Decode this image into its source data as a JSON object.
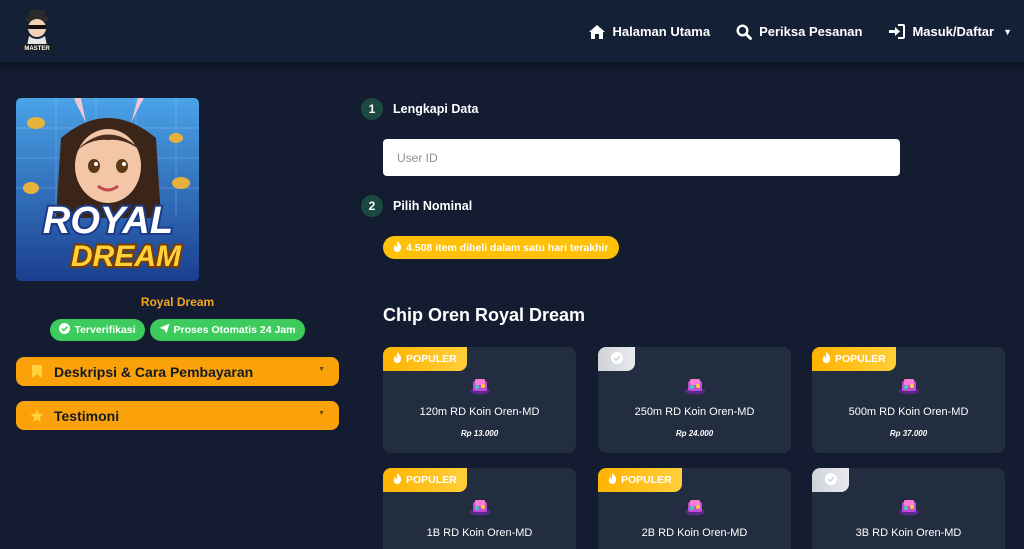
{
  "header": {
    "logo_text": "MASTER",
    "nav": [
      {
        "label": "Halaman Utama",
        "icon": "home-icon"
      },
      {
        "label": "Periksa Pesanan",
        "icon": "search-icon"
      },
      {
        "label": "Masuk/Daftar",
        "icon": "sign-in-icon"
      }
    ]
  },
  "game": {
    "image_text_top": "ROYAL",
    "image_text_bottom": "DREAM",
    "name": "Royal Dream",
    "badges": [
      {
        "label": "Terverifikasi",
        "icon": "check-circle-icon"
      },
      {
        "label": "Proses Otomatis 24 Jam",
        "icon": "paper-plane-icon"
      }
    ],
    "accordions": [
      {
        "label": "Deskripsi & Cara Pembayaran",
        "icon": "bookmark-icon"
      },
      {
        "label": "Testimoni",
        "icon": "star-icon"
      }
    ]
  },
  "form": {
    "step1": {
      "num": "1",
      "label": "Lengkapi Data"
    },
    "user_id_placeholder": "User ID",
    "user_id_value": "",
    "step2": {
      "num": "2",
      "label": "Pilih Nominal"
    },
    "sold_today": "4.508 item dibeli dalam satu hari terakhir"
  },
  "products": {
    "title": "Chip Oren Royal Dream",
    "items": [
      {
        "name": "120m RD Koin Oren-MD",
        "price": "Rp 13.000",
        "tag": "POPULER"
      },
      {
        "name": "250m RD Koin Oren-MD",
        "price": "Rp 24.000",
        "tag": ""
      },
      {
        "name": "500m RD Koin Oren-MD",
        "price": "Rp 37.000",
        "tag": "POPULER"
      },
      {
        "name": "1B RD Koin Oren-MD",
        "price": "",
        "tag": "POPULER"
      },
      {
        "name": "2B RD Koin Oren-MD",
        "price": "",
        "tag": "POPULER"
      },
      {
        "name": "3B RD Koin Oren-MD",
        "price": "",
        "tag": ""
      }
    ]
  },
  "colors": {
    "background": "#131c30",
    "navbar": "#142036",
    "accent_orange": "#fba20a",
    "badge_green": "#3ecb5e",
    "popular_yellow": "#ffc107",
    "card": "#232d40"
  }
}
